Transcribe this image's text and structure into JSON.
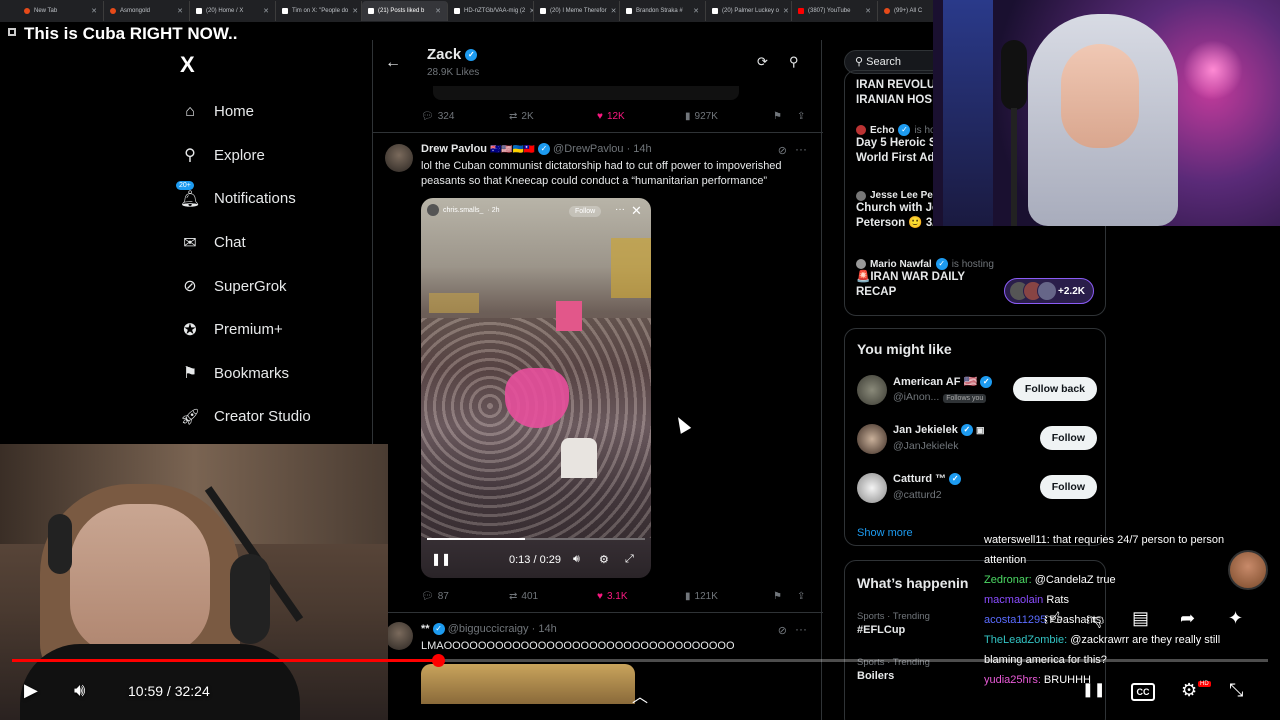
{
  "browser": {
    "tabs": [
      {
        "title": "New Tab",
        "favicon": "chrome-icon",
        "active": false
      },
      {
        "title": "Asmongold",
        "favicon": "generic-icon",
        "active": false
      },
      {
        "title": "(20) Home / X",
        "favicon": "x-icon",
        "active": false
      },
      {
        "title": "Tim on X: \"People do",
        "favicon": "x-icon",
        "active": false
      },
      {
        "title": "(21) Posts liked b",
        "favicon": "x-icon",
        "active": true
      },
      {
        "title": "HD-nZTGb/VAA-mig (2",
        "favicon": "x-icon",
        "active": false
      },
      {
        "title": "(20) I Meme Therefor",
        "favicon": "x-icon",
        "active": false
      },
      {
        "title": "Brandon Straka #",
        "favicon": "x-icon",
        "active": false
      },
      {
        "title": "(20) Palmer Luckey o",
        "favicon": "x-icon",
        "active": false
      },
      {
        "title": "(3807) YouTube",
        "favicon": "youtube-icon",
        "active": false
      },
      {
        "title": "(99+) All C",
        "favicon": "generic-icon",
        "active": false
      }
    ]
  },
  "video_title": "This is Cuba RIGHT NOW..",
  "nav": {
    "logo": "X",
    "items": [
      {
        "label": "Home",
        "icon": "home-icon"
      },
      {
        "label": "Explore",
        "icon": "search-icon"
      },
      {
        "label": "Notifications",
        "icon": "bell-icon",
        "badge": "20+"
      },
      {
        "label": "Chat",
        "icon": "mail-icon"
      },
      {
        "label": "SuperGrok",
        "icon": "grok-icon"
      },
      {
        "label": "Premium+",
        "icon": "premium-icon"
      },
      {
        "label": "Bookmarks",
        "icon": "bookmark-icon"
      },
      {
        "label": "Creator Studio",
        "icon": "rocket-icon"
      }
    ]
  },
  "header": {
    "name": "Zack",
    "likes": "28.9K Likes"
  },
  "prev_tweet_actions": {
    "replies": "324",
    "reposts": "2K",
    "likes": "12K",
    "views": "927K"
  },
  "tweet": {
    "name": "Drew Pavlou",
    "flags": "🇦🇺🇺🇸🇺🇦🇹🇼",
    "handle": "@DrewPavlou",
    "time": "· 14h",
    "text": "lol the Cuban communist dictatorship had to cut off power to impoverished peasants so that Kneecap could conduct a “humanitarian performance”",
    "video": {
      "author": "chris.smalls_",
      "age": "· 2h",
      "follow_label": "Follow",
      "time": "0:13 / 0:29",
      "progress": 0.45
    },
    "actions": {
      "replies": "87",
      "reposts": "401",
      "likes": "3.1K",
      "views": "121K"
    }
  },
  "next_tweet": {
    "name": "**",
    "handle": "@bigguccicraigy",
    "time": "· 14h",
    "text": "LMAOOOOOOOOOOOOOOOOOOOOOOOOOOOOOOOOOO"
  },
  "right": {
    "search_placeholder": "Search",
    "live": [
      {
        "host": "",
        "host_suffix": "",
        "title": "IRAN REVOLU\nIRANIAN HOS"
      },
      {
        "host": "Echo",
        "host_suffix": "is ho",
        "title": "Day 5 Heroic S\nWorld First Ad"
      },
      {
        "host": "Jesse Lee Pet",
        "host_suffix": "",
        "title": "Church with Je\nPeterson 🙂 3/22/26"
      },
      {
        "host": "Mario Nawfal",
        "host_suffix": "is hosting",
        "title": "🚨IRAN WAR DAILY\nRECAP"
      }
    ],
    "speaker_count": "+2.2K",
    "might_like_title": "You might like",
    "suggestions": [
      {
        "name": "American AF 🇺🇸",
        "handle": "@iAnon...",
        "follows_you": "Follows you",
        "button": "Follow back"
      },
      {
        "name": "Jan Jekielek",
        "handle": "@JanJekielek",
        "follows_you": "",
        "button": "Follow"
      },
      {
        "name": "Catturd ™",
        "handle": "@catturd2",
        "follows_you": "",
        "button": "Follow"
      }
    ],
    "show_more": "Show more",
    "happening_title": "What’s happenin",
    "trends": [
      {
        "category": "Sports · Trending",
        "title": "#EFLCup"
      },
      {
        "category": "Sports · Trending",
        "title": "Boilers"
      }
    ]
  },
  "chat": [
    {
      "user": "waterswell11:",
      "msg": " that requries 24/7 person to person",
      "color": "u1"
    },
    {
      "user": "",
      "msg": "attention",
      "color": "u1"
    },
    {
      "user": "Zedronar:",
      "msg": " @CandelaZ true",
      "color": "ug"
    },
    {
      "user": "macmaolain",
      "msg": " Rats",
      "color": "up"
    },
    {
      "user": "acosta11295",
      "msg": " Peashants",
      "color": "ub"
    },
    {
      "user": "TheLeadZombie:",
      "msg": " @zackrawrr are they really still",
      "color": "ut"
    },
    {
      "user": "",
      "msg": "blaming america for this?",
      "color": "u1"
    },
    {
      "user": "yudia25hrs:",
      "msg": " BRUHHH",
      "color": "um"
    }
  ],
  "player": {
    "time": "10:59 / 32:24",
    "progress": 0.339,
    "hd_label": "HD",
    "cc_label": "CC"
  }
}
